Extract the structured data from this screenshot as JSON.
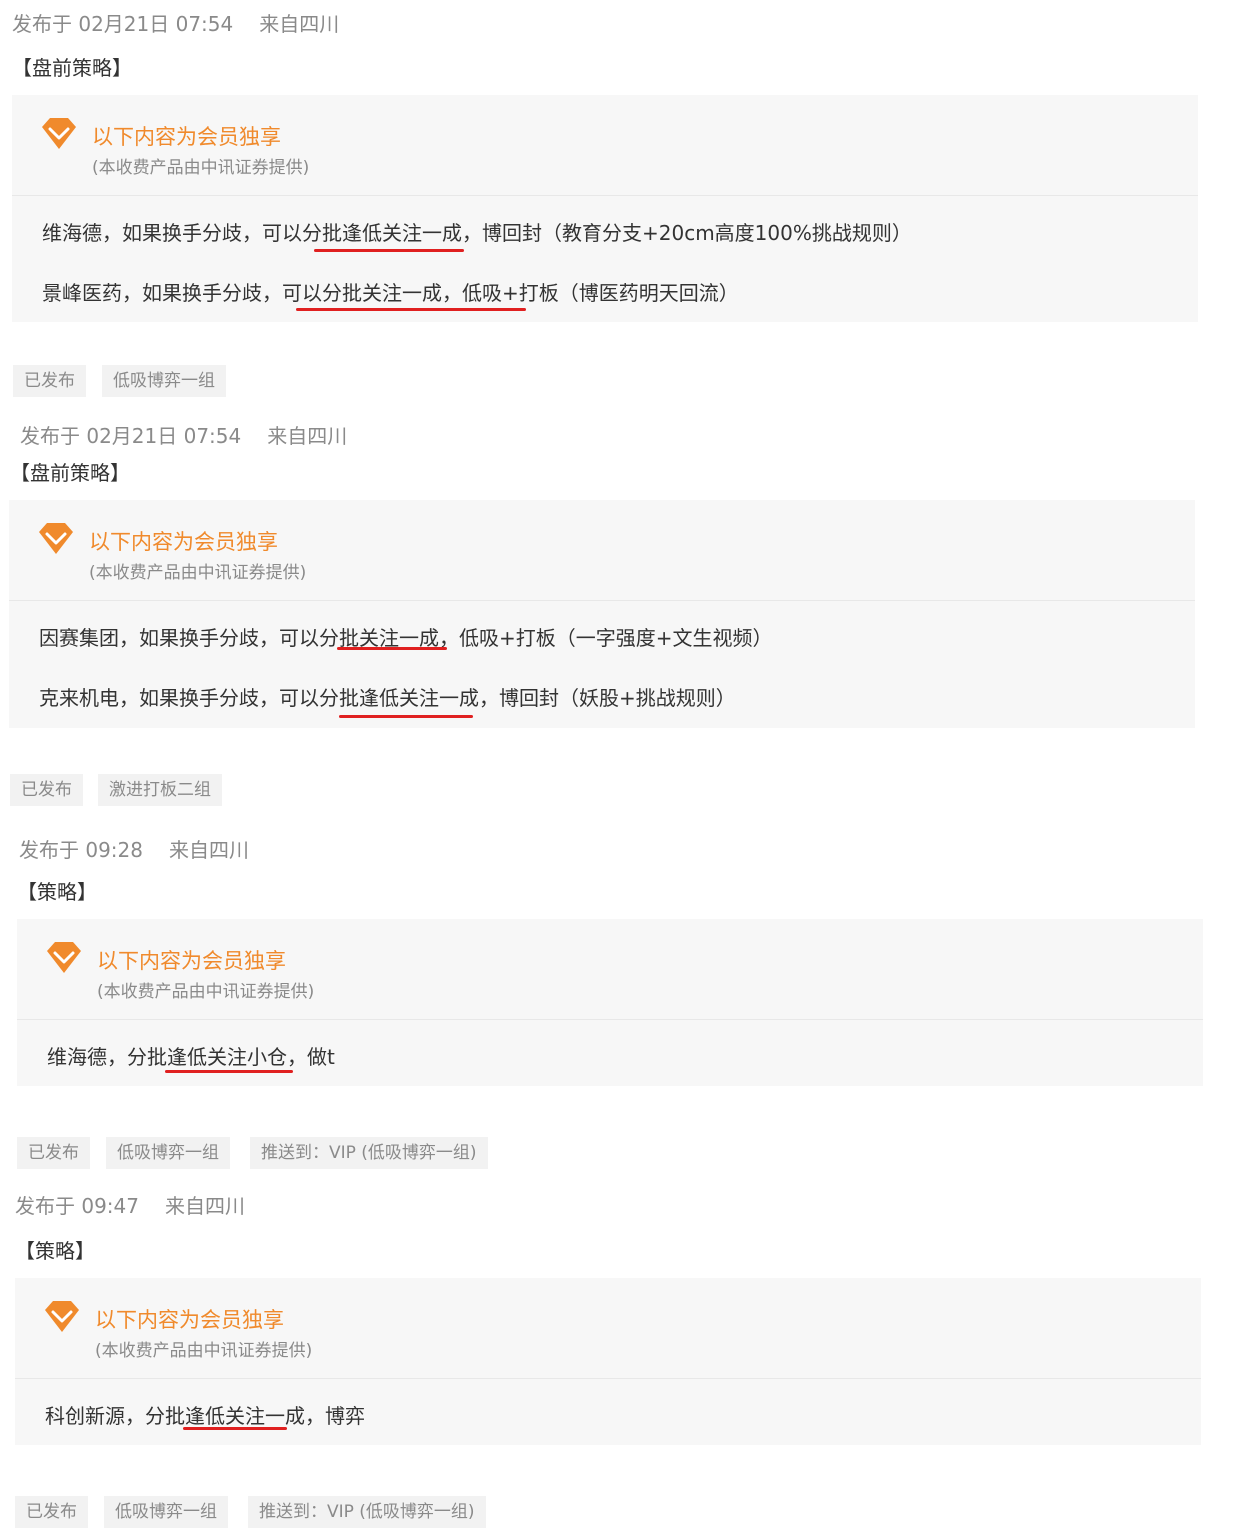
{
  "colors": {
    "accent": "#f08a2c",
    "underline": "#e02020",
    "box_bg": "#f7f7f7",
    "tag_bg": "#f2f2f2"
  },
  "icons": {
    "vip": "diamond-icon"
  },
  "posts": [
    {
      "time": "发布于 02月21日 07:54",
      "location": "来自四川",
      "heading": "【盘前策略】",
      "vip_title": "以下内容为会员独享",
      "vip_subtitle": "(本收费产品由中讯证券提供)",
      "lines": [
        "维海德，如果换手分歧，可以分批逢低关注一成，博回封（教育分支+20cm高度100%挑战规则）",
        "景峰医药，如果换手分歧，可以分批关注一成，低吸+打板（博医药明天回流）"
      ],
      "tags": [
        "已发布",
        "低吸博弈一组"
      ]
    },
    {
      "time": "发布于 02月21日 07:54",
      "location": "来自四川",
      "heading": "【盘前策略】",
      "vip_title": "以下内容为会员独享",
      "vip_subtitle": "(本收费产品由中讯证券提供)",
      "lines": [
        "因赛集团，如果换手分歧，可以分批关注一成，低吸+打板（一字强度+文生视频）",
        "克来机电，如果换手分歧，可以分批逢低关注一成，博回封（妖股+挑战规则）"
      ],
      "tags": [
        "已发布",
        "激进打板二组"
      ]
    },
    {
      "time": "发布于 09:28",
      "location": "来自四川",
      "heading": "【策略】",
      "vip_title": "以下内容为会员独享",
      "vip_subtitle": "(本收费产品由中讯证券提供)",
      "lines": [
        "维海德，分批逢低关注小仓，做t"
      ],
      "tags": [
        "已发布",
        "低吸博弈一组",
        "推送到：VIP (低吸博弈一组)"
      ]
    },
    {
      "time": "发布于 09:47",
      "location": "来自四川",
      "heading": "【策略】",
      "vip_title": "以下内容为会员独享",
      "vip_subtitle": "(本收费产品由中讯证券提供)",
      "lines": [
        "科创新源，分批逢低关注一成，博弈"
      ],
      "tags": [
        "已发布",
        "低吸博弈一组",
        "推送到：VIP (低吸博弈一组)"
      ]
    }
  ]
}
